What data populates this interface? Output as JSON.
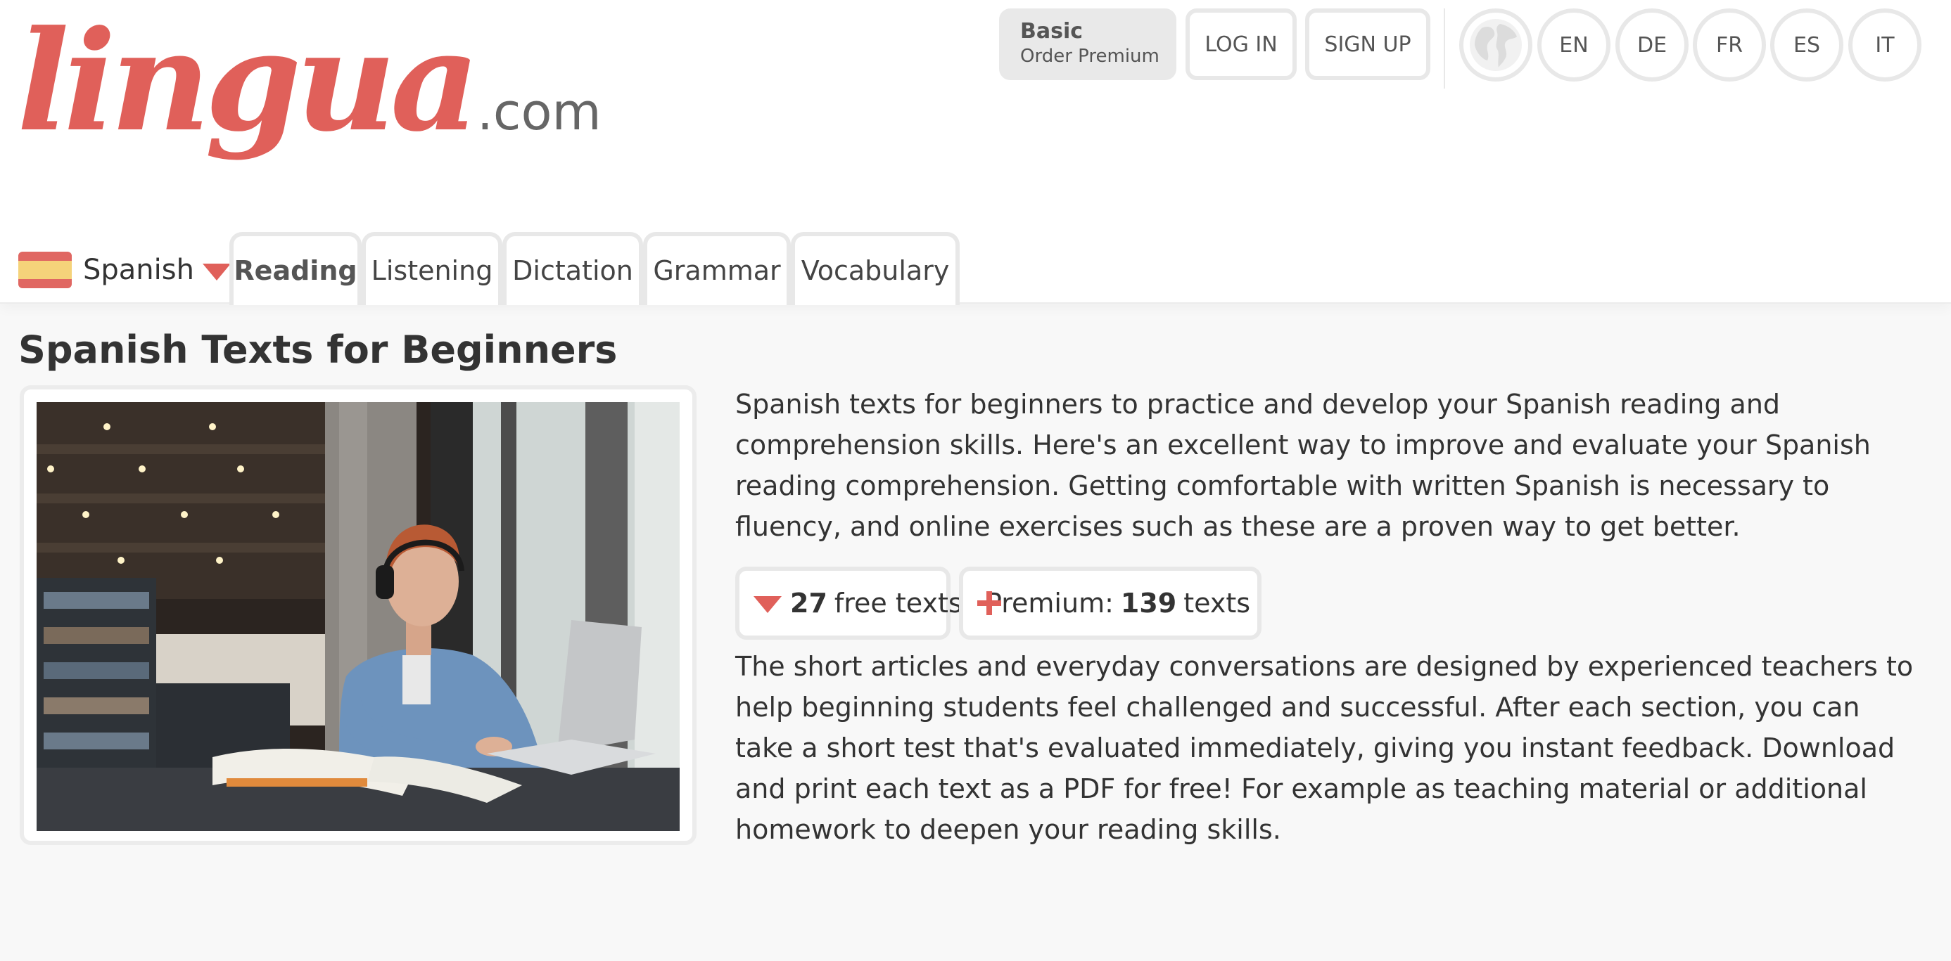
{
  "logo": {
    "main": "lingua",
    "tld": ".com"
  },
  "account": {
    "plan": "Basic",
    "upgrade": "Order Premium",
    "login": "LOG IN",
    "signup": "SIGN UP"
  },
  "site_languages": [
    "EN",
    "DE",
    "FR",
    "ES",
    "IT"
  ],
  "course": {
    "language": "Spanish",
    "flag": "spain-flag-icon"
  },
  "tabs": [
    {
      "label": "Reading",
      "active": true
    },
    {
      "label": "Listening",
      "active": false
    },
    {
      "label": "Dictation",
      "active": false
    },
    {
      "label": "Grammar",
      "active": false
    },
    {
      "label": "Vocabulary",
      "active": false
    }
  ],
  "page": {
    "title": "Spanish Texts for Beginners",
    "intro": "Spanish texts for beginners to practice and develop your Spanish reading and comprehension skills. Here's an excellent way to improve and evaluate your Spanish reading comprehension. Getting comfortable with written Spanish is necessary to fluency, and online exercises such as these are a proven way to get better.",
    "free_chip": {
      "count": "27",
      "label": "free texts"
    },
    "premium_chip": {
      "prefix": "Premium:",
      "count": "139",
      "label": "texts"
    },
    "body": "The short articles and everyday conversations are designed by experienced teachers to help beginning students feel challenged and successful. After each section, you can take a short test that's evaluated immediately, giving you instant feedback. Download and print each text as a PDF for free! For example as teaching material or additional homework to deepen your reading skills."
  },
  "colors": {
    "brand": "#e0605a",
    "flag_red": "#e06762",
    "flag_yellow": "#f5d37a",
    "background": "#f8f8f8"
  }
}
